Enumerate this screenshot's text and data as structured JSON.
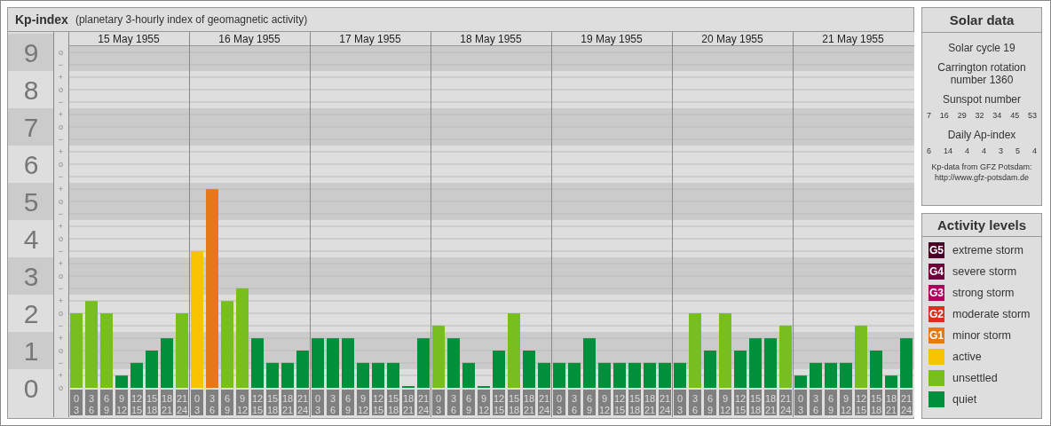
{
  "title": {
    "name": "Kp-index",
    "subtitle": "(planetary 3-hourly index of geomagnetic activity)"
  },
  "days": [
    "15 May 1955",
    "16 May 1955",
    "17 May 1955",
    "18 May 1955",
    "19 May 1955",
    "20 May 1955",
    "21 May 1955"
  ],
  "third_marks": [
    "o",
    "−",
    "+",
    "o",
    "−",
    "+",
    "o",
    "−",
    "+",
    "o",
    "−",
    "+",
    "o",
    "−",
    "+",
    "o",
    "−",
    "+",
    "o",
    "−",
    "+",
    "o",
    "−",
    "+",
    "o",
    "−",
    "+",
    "o"
  ],
  "chart_data": {
    "type": "bar",
    "ylim": [
      0,
      9.19
    ],
    "yticks": [
      0,
      1,
      2,
      3,
      4,
      5,
      6,
      7,
      8,
      9
    ],
    "grid": true,
    "categories": [
      "0\n3",
      "3\n6",
      "6\n9",
      "9\n12",
      "12\n15",
      "15\n18",
      "18\n21",
      "21\n24",
      "0\n3",
      "3\n6",
      "6\n9",
      "9\n12",
      "12\n15",
      "15\n18",
      "18\n21",
      "21\n24",
      "0\n3",
      "3\n6",
      "6\n9",
      "9\n12",
      "12\n15",
      "15\n18",
      "18\n21",
      "21\n24",
      "0\n3",
      "3\n6",
      "6\n9",
      "9\n12",
      "12\n15",
      "15\n18",
      "18\n21",
      "21\n24",
      "0\n3",
      "3\n6",
      "6\n9",
      "9\n12",
      "12\n15",
      "15\n18",
      "18\n21",
      "21\n24",
      "0\n3",
      "3\n6",
      "6\n9",
      "9\n12",
      "12\n15",
      "15\n18",
      "18\n21",
      "21\n24",
      "0\n3",
      "3\n6",
      "6\n9",
      "9\n12",
      "12\n15",
      "15\n18",
      "18\n21",
      "21\n24"
    ],
    "series": [
      {
        "values": [
          2,
          2.33,
          2,
          0.33,
          0.67,
          1,
          1.33,
          2,
          3.67,
          5.33,
          2.33,
          2.67,
          1.33,
          0.67,
          0.67,
          1,
          1.33,
          1.33,
          1.33,
          0.67,
          0.67,
          0.67,
          0,
          1.33,
          1.67,
          1.33,
          0.67,
          0,
          1,
          2,
          1,
          0.67,
          0.67,
          0.67,
          1.33,
          0.67,
          0.67,
          0.67,
          0.67,
          0.67,
          0.67,
          2,
          1,
          2,
          1,
          1.33,
          1.33,
          1.67,
          0.33,
          0.67,
          0.67,
          0.67,
          1.67,
          1,
          0.33,
          1.33
        ]
      }
    ]
  },
  "solar": {
    "title": "Solar data",
    "cycle": "Solar cycle 19",
    "rotation": "Carrington rotation number 1360",
    "sunspot_label": "Sunspot number",
    "sunspot_numbers": [
      "7",
      "16",
      "29",
      "32",
      "34",
      "45",
      "53"
    ],
    "ap_label": "Daily Ap-index",
    "ap_values": [
      "6",
      "14",
      "4",
      "4",
      "3",
      "5",
      "4"
    ],
    "source": "Kp-data from GFZ Potsdam:",
    "source_url": "http://www.gfz-potsdam.de"
  },
  "legend": {
    "title": "Activity levels",
    "items": [
      {
        "badge": "G5",
        "label": "extreme storm",
        "color": "#4d0026"
      },
      {
        "badge": "G4",
        "label": "severe storm",
        "color": "#6e003e"
      },
      {
        "badge": "G3",
        "label": "strong storm",
        "color": "#b0005e"
      },
      {
        "badge": "G2",
        "label": "moderate storm",
        "color": "#d9301e"
      },
      {
        "badge": "G1",
        "label": "minor storm",
        "color": "#e57817"
      },
      {
        "label": "active",
        "color": "#f8c300"
      },
      {
        "label": "unsettled",
        "color": "#77bf1f"
      },
      {
        "label": "quiet",
        "color": "#00903c"
      }
    ]
  }
}
